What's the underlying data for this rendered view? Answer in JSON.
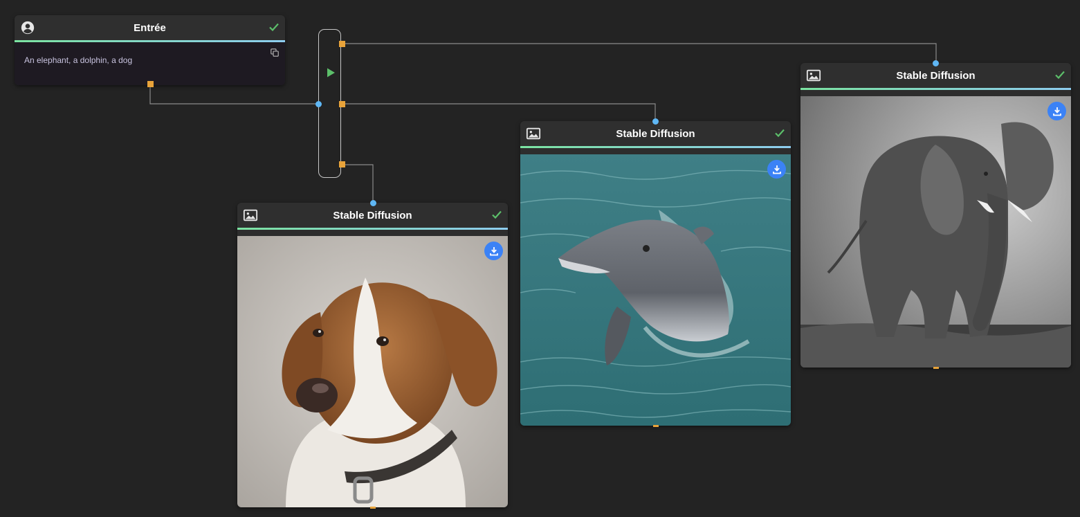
{
  "input_node": {
    "title": "Entrée",
    "icon": "user-circle-icon",
    "prompt": "An elephant, a dolphin, a dog",
    "status": "check-icon"
  },
  "splitter": {
    "icon": "play-icon"
  },
  "generators": [
    {
      "title": "Stable Diffusion",
      "subject": "dog",
      "icon": "image-icon",
      "status": "check-icon",
      "action": "download-icon"
    },
    {
      "title": "Stable Diffusion",
      "subject": "dolphin",
      "icon": "image-icon",
      "status": "check-icon",
      "action": "download-icon"
    },
    {
      "title": "Stable Diffusion",
      "subject": "elephant",
      "icon": "image-icon",
      "status": "check-icon",
      "action": "download-icon"
    }
  ],
  "colors": {
    "background": "#232323",
    "accent_green": "#7be3a1",
    "accent_blue": "#8ecdf0",
    "port_orange": "#e8a33a",
    "port_blue": "#5fb7f5",
    "download_blue": "#3b82f6",
    "check_green": "#5cbf6a"
  }
}
